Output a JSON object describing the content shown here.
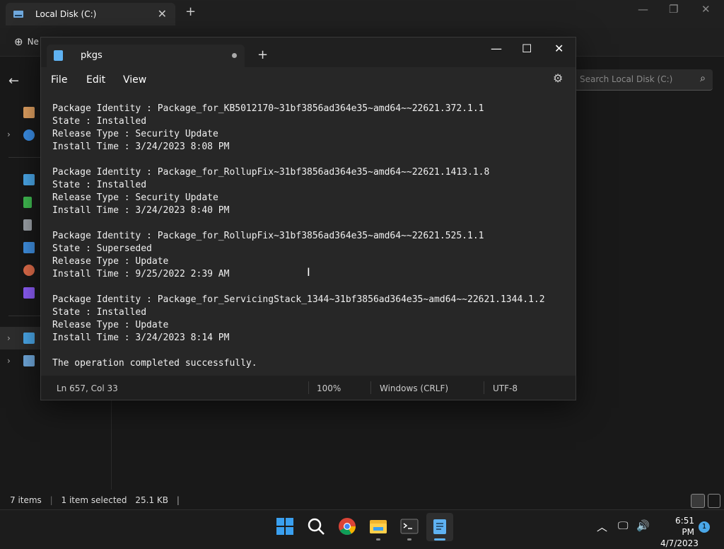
{
  "explorer": {
    "tab_title": "Local Disk (C:)",
    "new_button": "Ne",
    "search_placeholder": "Search Local Disk (C:)",
    "status": {
      "items": "7 items",
      "selected": "1 item selected",
      "size": "25.1 KB"
    }
  },
  "notepad": {
    "tab_title": "pkgs",
    "menu": {
      "file": "File",
      "edit": "Edit",
      "view": "View"
    },
    "content": "Package Identity : Package_for_KB5012170~31bf3856ad364e35~amd64~~22621.372.1.1\nState : Installed\nRelease Type : Security Update\nInstall Time : 3/24/2023 8:08 PM\n\nPackage Identity : Package_for_RollupFix~31bf3856ad364e35~amd64~~22621.1413.1.8\nState : Installed\nRelease Type : Security Update\nInstall Time : 3/24/2023 8:40 PM\n\nPackage Identity : Package_for_RollupFix~31bf3856ad364e35~amd64~~22621.525.1.1\nState : Superseded\nRelease Type : Update\nInstall Time : 9/25/2022 2:39 AM\n\nPackage Identity : Package_for_ServicingStack_1344~31bf3856ad364e35~amd64~~22621.1344.1.2\nState : Installed\nRelease Type : Update\nInstall Time : 3/24/2023 8:14 PM\n\nThe operation completed successfully.",
    "status": {
      "position": "Ln 657, Col 33",
      "zoom": "100%",
      "line_ending": "Windows (CRLF)",
      "encoding": "UTF-8"
    }
  },
  "taskbar": {
    "time": "6:51 PM",
    "date": "4/7/2023",
    "notification_count": "1",
    "apps": [
      "start-icon",
      "search-icon",
      "chrome-icon",
      "file-explorer-icon",
      "terminal-icon",
      "notepad-icon"
    ]
  }
}
